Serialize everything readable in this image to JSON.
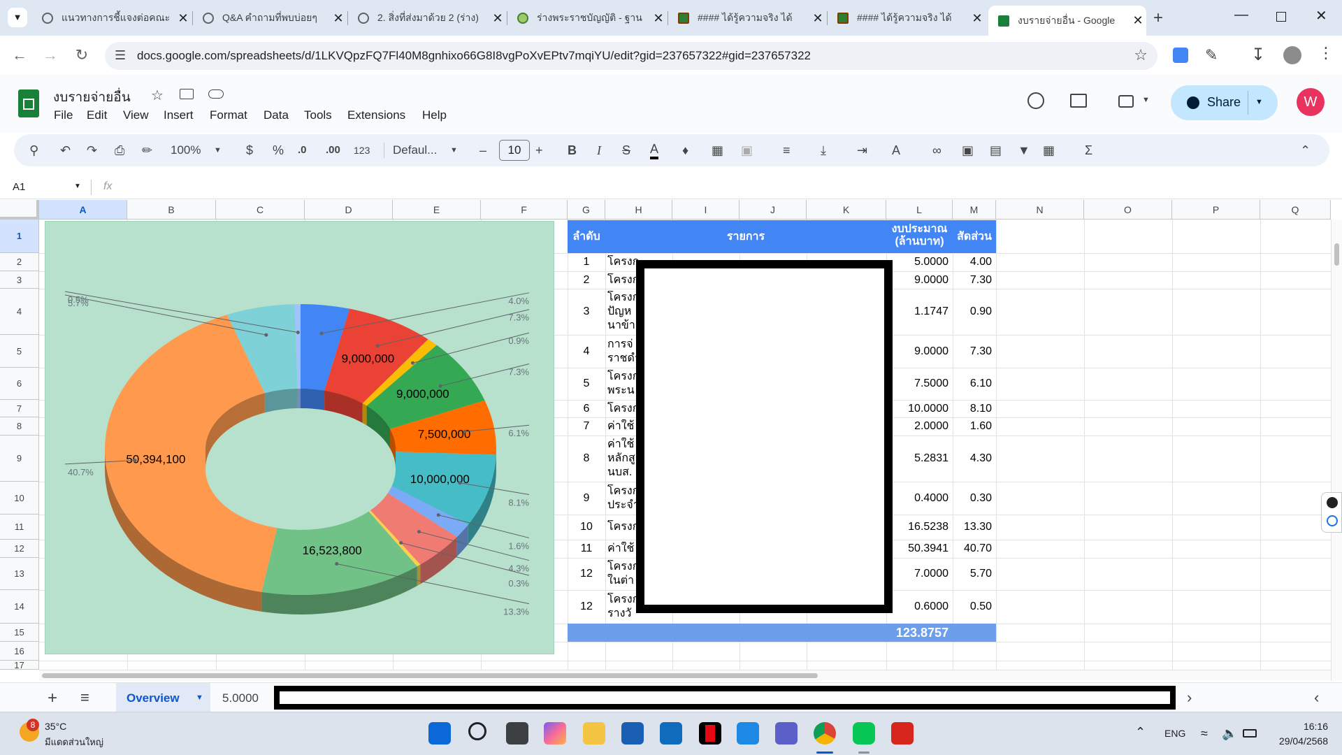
{
  "browser": {
    "tabs": [
      {
        "title": "แนวทางการชี้แจงต่อคณะ"
      },
      {
        "title": "Q&A คำถามที่พบบ่อยๆ"
      },
      {
        "title": "2. สิ่งที่ส่งมาด้วย 2 (ร่าง)"
      },
      {
        "title": "ร่างพระราชบัญญัติ - ฐาน"
      },
      {
        "title": "#### ได้รู้ความจริง ได้"
      },
      {
        "title": "#### ได้รู้ความจริง ได้"
      },
      {
        "title": "งบรายจ่ายอื่น - Google"
      }
    ],
    "url": "docs.google.com/spreadsheets/d/1LKVQpzFQ7Fl40M8gnhixo66G8I8vgPoXvEPtv7mqiYU/edit?gid=237657322#gid=237657322"
  },
  "doc": {
    "title": "งบรายจ่ายอื่น",
    "menus": [
      "File",
      "Edit",
      "View",
      "Insert",
      "Format",
      "Data",
      "Tools",
      "Extensions",
      "Help"
    ],
    "share_label": "Share",
    "avatar_letter": "W"
  },
  "toolbar": {
    "zoom": "100%",
    "currency": "$",
    "percent": "%",
    "dec_less": ".0",
    "dec_more": ".00",
    "number_format": "123",
    "font": "Defaul...",
    "font_size": "10",
    "bold": "B",
    "italic": "I"
  },
  "formula_bar": {
    "name_box": "A1",
    "fx": "fx"
  },
  "grid": {
    "columns": [
      "A",
      "B",
      "C",
      "D",
      "E",
      "F",
      "G",
      "H",
      "I",
      "J",
      "K",
      "L",
      "M",
      "N",
      "O",
      "P",
      "Q"
    ],
    "rows": [
      "1",
      "2",
      "3",
      "4",
      "5",
      "6",
      "7",
      "8",
      "9",
      "10",
      "11",
      "12",
      "13",
      "14",
      "15",
      "16",
      "17"
    ]
  },
  "table": {
    "headers": {
      "no": "ลำดับ",
      "item": "รายการ",
      "budget_1": "งบประมาณ",
      "budget_2": "(ล้านบาท)",
      "ratio": "สัดส่วน"
    },
    "rows": [
      {
        "no": "1",
        "item": "โครงก",
        "budget": "5.0000",
        "ratio": "4.00"
      },
      {
        "no": "2",
        "item": "โครงก",
        "budget": "9.0000",
        "ratio": "7.30"
      },
      {
        "no": "3",
        "item": "โครงก",
        "item2": "ปัญห",
        "item3": "นาข้า",
        "budget": "1.1747",
        "ratio": "0.90"
      },
      {
        "no": "4",
        "item": "การจ่",
        "item2": "ราชดำ",
        "budget": "9.0000",
        "ratio": "7.30"
      },
      {
        "no": "5",
        "item": "โครงก",
        "item2": "พระน",
        "budget": "7.5000",
        "ratio": "6.10"
      },
      {
        "no": "6",
        "item": "โครงก",
        "budget": "10.0000",
        "ratio": "8.10"
      },
      {
        "no": "7",
        "item": "ค่าใช้",
        "budget": "2.0000",
        "ratio": "1.60"
      },
      {
        "no": "8",
        "item": "ค่าใช้",
        "item2": "หลักสู",
        "item3": "นบส.",
        "budget": "5.2831",
        "ratio": "4.30"
      },
      {
        "no": "9",
        "item": "โครงก",
        "item2": "ประจำ",
        "budget": "0.4000",
        "ratio": "0.30"
      },
      {
        "no": "10",
        "item": "โครงก",
        "budget": "16.5238",
        "ratio": "13.30"
      },
      {
        "no": "11",
        "item": "ค่าใช้",
        "budget": "50.3941",
        "ratio": "40.70"
      },
      {
        "no": "12",
        "item": "โครงก",
        "item2": "ในต่า",
        "budget": "7.0000",
        "ratio": "5.70"
      },
      {
        "no": "12",
        "item": "โครงก",
        "item2": "รางวั",
        "budget": "0.6000",
        "ratio": "0.50"
      }
    ],
    "total": "123.8757"
  },
  "chart_data": {
    "type": "pie",
    "style": "3d-donut",
    "background": "#b7e1cd",
    "slices": [
      {
        "value": 5000000,
        "percent_label": "4.0%",
        "color": "#4285f4"
      },
      {
        "value": 9000000,
        "value_label": "9,000,000",
        "percent_label": "7.3%",
        "color": "#ea4335"
      },
      {
        "value": 1174700,
        "percent_label": "0.9%",
        "color": "#fbbc04"
      },
      {
        "value": 9000000,
        "value_label": "9,000,000",
        "percent_label": "7.3%",
        "color": "#34a853"
      },
      {
        "value": 7500000,
        "value_label": "7,500,000",
        "percent_label": "6.1%",
        "color": "#ff6d01"
      },
      {
        "value": 10000000,
        "value_label": "10,000,000",
        "percent_label": "8.1%",
        "color": "#46bdc6"
      },
      {
        "value": 2000000,
        "percent_label": "1.6%",
        "color": "#7baaf7"
      },
      {
        "value": 5283100,
        "percent_label": "4.3%",
        "color": "#f07b72"
      },
      {
        "value": 400000,
        "percent_label": "0.3%",
        "color": "#fcd04f"
      },
      {
        "value": 16523800,
        "value_label": "16,523,800",
        "percent_label": "13.3%",
        "color": "#71c287"
      },
      {
        "value": 50394100,
        "value_label": "50,394,100",
        "percent_label": "40.7%",
        "color": "#ff994d"
      },
      {
        "value": 7000000,
        "percent_label": "5.7%",
        "color": "#7ed1d7"
      },
      {
        "value": 600000,
        "percent_label": "0.5%",
        "color": "#a0c3ff"
      }
    ]
  },
  "sheet_tabs": {
    "active": "Overview",
    "cell_value": "5.0000"
  },
  "taskbar": {
    "weather_temp": "35°C",
    "weather_desc": "มีแดดส่วนใหญ่",
    "weather_badge": "8",
    "lang": "ENG",
    "time": "16:16",
    "date": "29/04/2568"
  }
}
